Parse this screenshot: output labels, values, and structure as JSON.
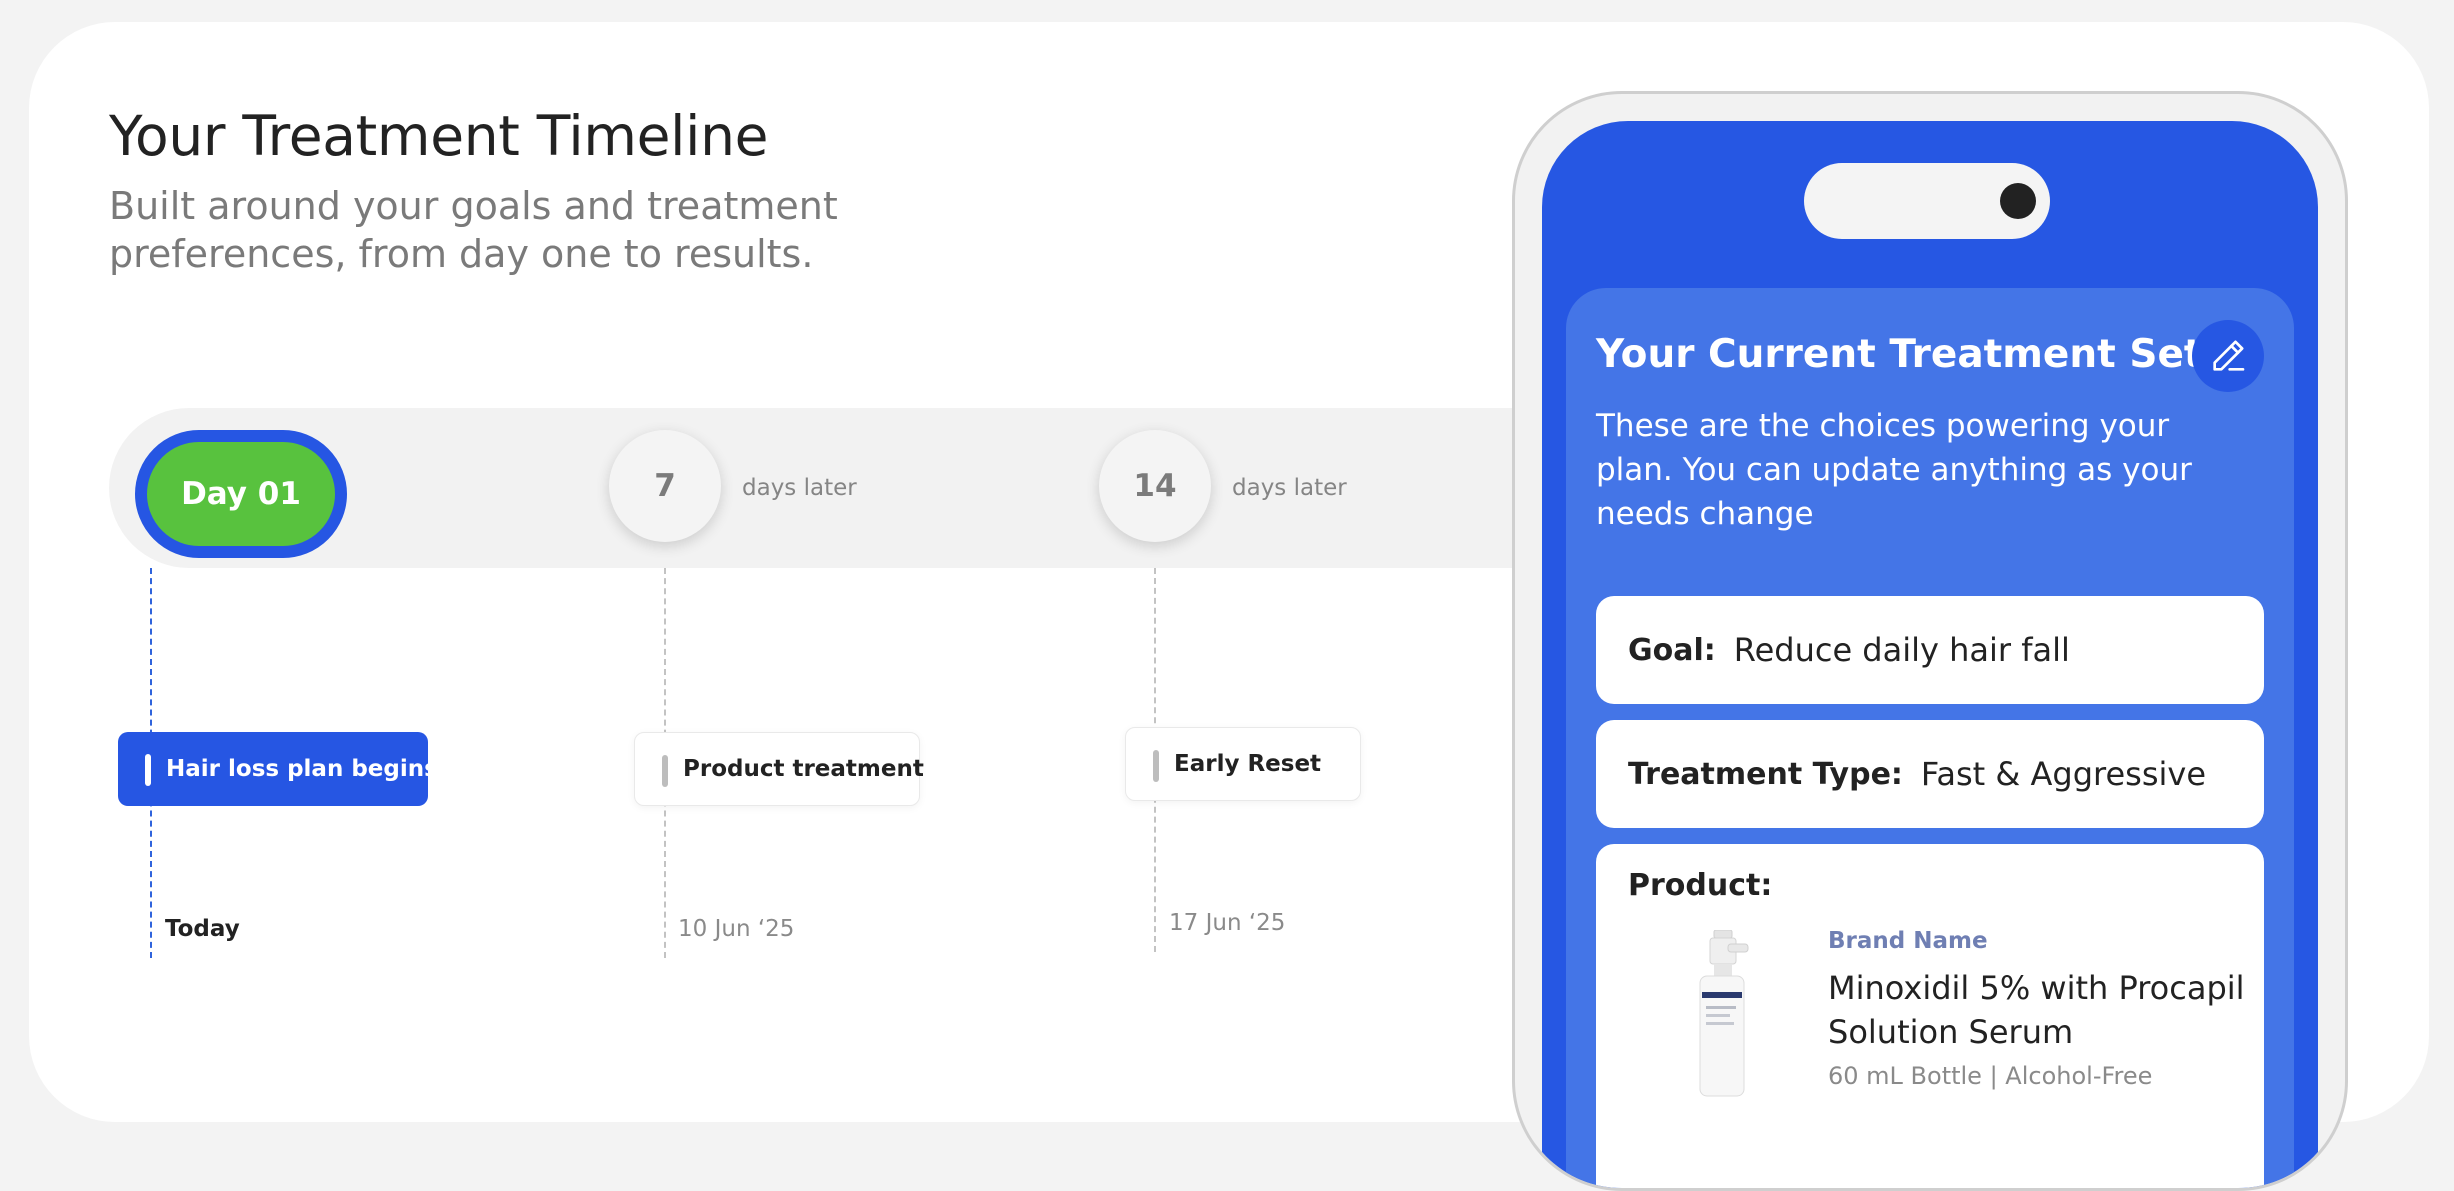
{
  "header": {
    "title": "Your Treatment Timeline",
    "subtitle": "Built around your goals and treatment preferences, from day one to results."
  },
  "timeline": {
    "start_label": "Day 01",
    "steps": [
      {
        "number": "7",
        "suffix": "days later"
      },
      {
        "number": "14",
        "suffix": "days later"
      }
    ],
    "events": [
      {
        "label": "Hair loss plan begins",
        "date": "Today"
      },
      {
        "label": "Product treatment",
        "date": "10 Jun ‘25"
      },
      {
        "label": "Early Reset",
        "date": "17 Jun ‘25"
      }
    ]
  },
  "phone": {
    "panel_title": "Your Current Treatment Setup",
    "panel_description": "These are the choices powering your plan. You can update anything as your needs change",
    "edit_icon": "pencil-icon",
    "goal": {
      "label": "Goal:",
      "value": "Reduce daily hair fall"
    },
    "treatment_type": {
      "label": "Treatment Type:",
      "value": "Fast & Aggressive"
    },
    "product": {
      "label": "Product:",
      "brand": "Brand Name",
      "name": "Minoxidil 5% with Procapil Solution Serum",
      "meta": "60 mL Bottle | Alcohol-Free"
    }
  },
  "colors": {
    "primary_blue": "#2656e3",
    "panel_blue": "#4475e7",
    "start_green": "#58c23e"
  }
}
